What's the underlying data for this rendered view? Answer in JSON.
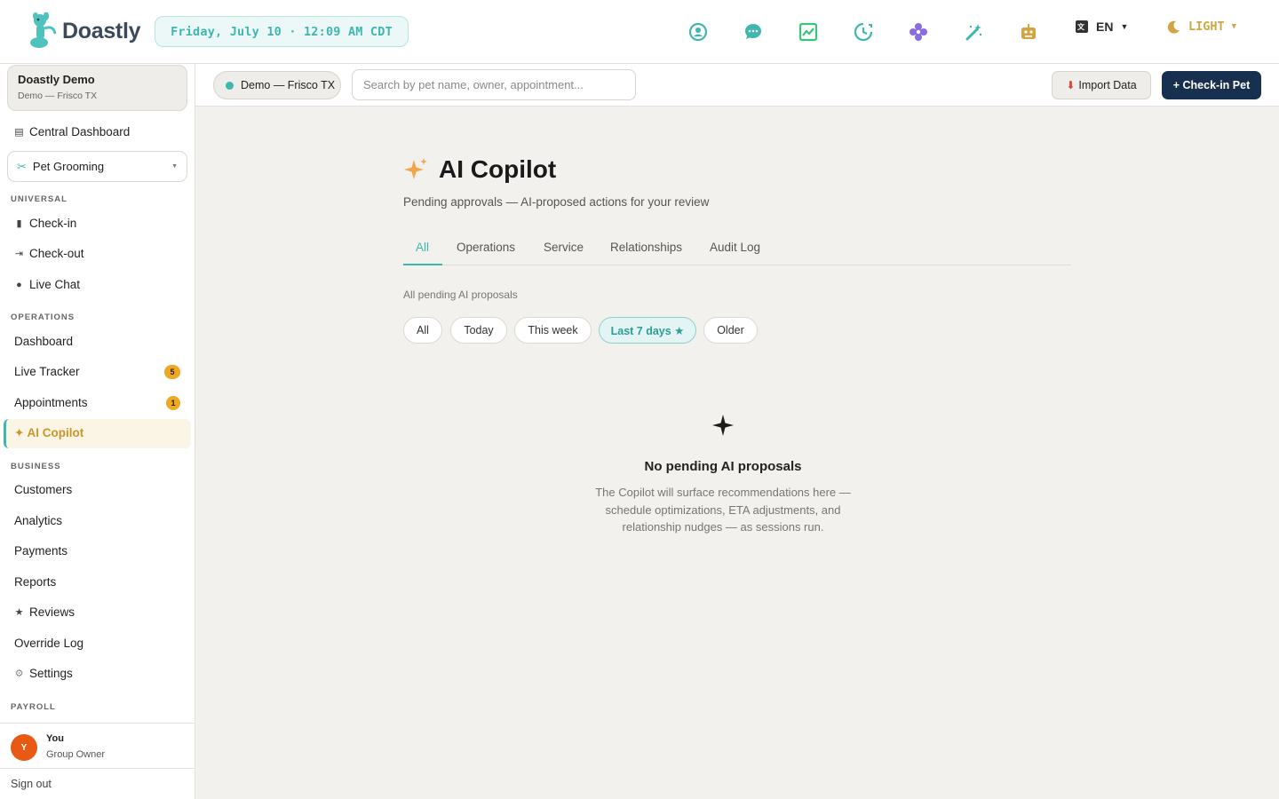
{
  "app": {
    "name": "Doastly"
  },
  "topbar": {
    "datetime": "Friday, July 10 · 12:09 AM CDT",
    "icons": [
      "person-icon",
      "chat-icon",
      "chart-icon",
      "clock-icon",
      "flower-icon",
      "magic-wand-icon",
      "robot-icon"
    ],
    "language": "EN",
    "theme": "LIGHT"
  },
  "sidebar": {
    "org_name": "Doastly Demo",
    "org_sub": "Demo — Frisco TX",
    "central_dashboard": "Central Dashboard",
    "service_select": "Pet Grooming",
    "universal_label": "UNIVERSAL",
    "checkin": "Check-in",
    "checkout": "Check-out",
    "live_chat": "Live Chat",
    "operations_label": "OPERATIONS",
    "dashboard": "Dashboard",
    "live_tracker": "Live Tracker",
    "live_tracker_badge": "5",
    "appointments": "Appointments",
    "appointments_badge": "1",
    "ai_copilot": "✦ AI Copilot",
    "business_label": "BUSINESS",
    "customers": "Customers",
    "analytics": "Analytics",
    "payments": "Payments",
    "reports": "Reports",
    "reviews": "Reviews",
    "override_log": "Override Log",
    "settings": "Settings",
    "payroll_label": "PAYROLL",
    "user_initial": "Y",
    "user_name": "You",
    "user_role": "Group Owner",
    "sign_out": "Sign out"
  },
  "subbar": {
    "location": "Demo — Frisco TX",
    "search_placeholder": "Search by pet name, owner, appointment...",
    "import_label": "Import Data",
    "checkin_label": "+ Check-in Pet"
  },
  "main": {
    "title": "AI Copilot",
    "subtitle": "Pending approvals — AI-proposed actions for your review",
    "tabs": [
      "All",
      "Operations",
      "Service",
      "Relationships",
      "Audit Log"
    ],
    "filter_caption": "All pending AI proposals",
    "chips": [
      "All",
      "Today",
      "This week",
      "Last 7 days ★",
      "Older"
    ],
    "empty_title": "No pending AI proposals",
    "empty_desc": "The Copilot will surface recommendations here — schedule optimizations, ETA adjustments, and relationship nudges — as sessions run."
  },
  "colors": {
    "accent": "#3fb6b0",
    "gold": "#d4a443",
    "navy": "#18304f",
    "badge": "#f0a722"
  }
}
